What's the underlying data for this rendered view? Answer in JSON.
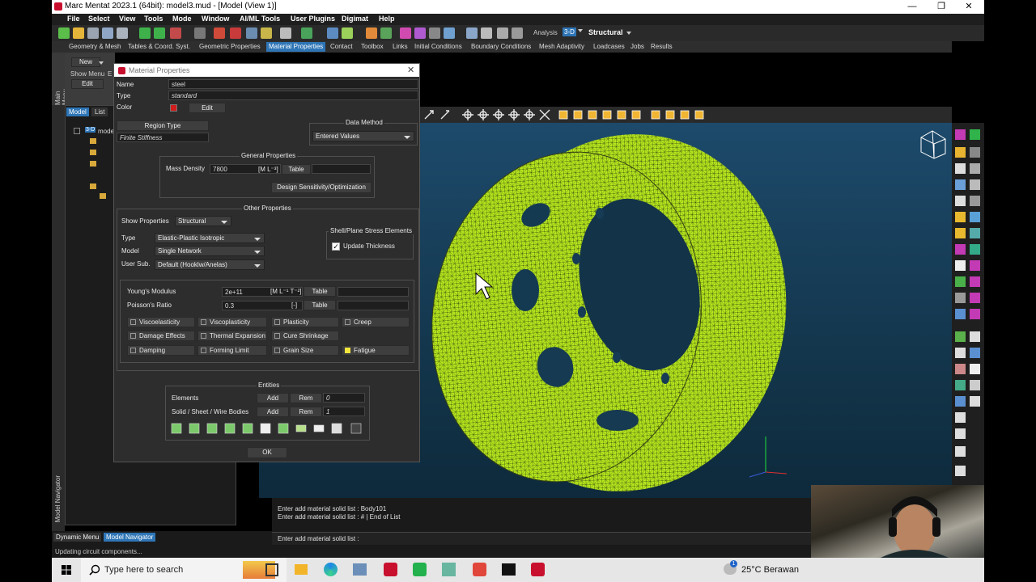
{
  "window": {
    "title": "Marc Mentat 2023.1 (64bit): model3.mud - [Model (View 1)]",
    "controls": [
      "—",
      "❐",
      "✕"
    ]
  },
  "menubar": [
    "File",
    "Select",
    "View",
    "Tools",
    "Mode",
    "Window",
    "AI/ML Tools",
    "User Plugins",
    "Digimat",
    "Help"
  ],
  "toolbar": {
    "analysis_label": "Analysis",
    "analysis_dim": "3-D",
    "analysis_type": "Structural"
  },
  "tabs": [
    "Geometry & Mesh",
    "Tables & Coord. Syst.",
    "Geometric Properties",
    "Material Properties",
    "Contact",
    "Toolbox",
    "Links",
    "Initial Conditions",
    "Boundary Conditions",
    "Mesh Adaptivity",
    "Loadcases",
    "Jobs",
    "Results"
  ],
  "active_tab": "Material Properties",
  "left_panel": {
    "main_menu_label": "Main Menu",
    "new_button": "New",
    "show_menu": "Show Menu",
    "show_menu_suffix": "E",
    "edit_button": "Edit",
    "tree_tabs": [
      "Model",
      "List"
    ],
    "tree_root": "mode",
    "tree_root_prefix": "3-D",
    "nav_label": "Model Navigator"
  },
  "dialog": {
    "title": "Material Properties",
    "name_label": "Name",
    "name_value": "steel",
    "type_label": "Type",
    "type_value": "standard",
    "color_label": "Color",
    "color_value": "#d01c1c",
    "edit_button": "Edit",
    "region_type_label": "Region Type",
    "region_type_value": "Finite Stiffness",
    "data_method_label": "Data Method",
    "data_method_value": "Entered Values",
    "general_properties": {
      "title": "General Properties",
      "mass_density_label": "Mass Density",
      "mass_density_value": "7800",
      "mass_density_unit": "[M L⁻³]",
      "table_button": "Table",
      "design_button": "Design Sensitivity/Optimization"
    },
    "other_properties": {
      "title": "Other Properties",
      "show_properties_label": "Show Properties",
      "show_properties_value": "Structural",
      "type_label": "Type",
      "type_value": "Elastic-Plastic Isotropic",
      "model_label": "Model",
      "model_value": "Single Network",
      "usersub_label": "User Sub.",
      "usersub_value": "Default (Hooklw/Anelas)",
      "shell_group_title": "Shell/Plane Stress Elements",
      "update_thickness_label": "Update Thickness",
      "update_thickness_checked": true,
      "youngs_label": "Young's Modulus",
      "youngs_value": "2e+11",
      "youngs_unit": "[M L⁻¹ T⁻²]",
      "poisson_label": "Poisson's Ratio",
      "poisson_value": "0.3",
      "poisson_unit": "[-]",
      "table_button": "Table",
      "options": [
        {
          "label": "Viscoelasticity",
          "checked": false
        },
        {
          "label": "Viscoplasticity",
          "checked": false
        },
        {
          "label": "Plasticity",
          "checked": false
        },
        {
          "label": "Creep",
          "checked": false
        },
        {
          "label": "Damage Effects",
          "checked": false
        },
        {
          "label": "Thermal Expansion",
          "checked": false
        },
        {
          "label": "Cure Shrinkage",
          "checked": false
        },
        {
          "label": "Damping",
          "checked": false
        },
        {
          "label": "Forming Limit",
          "checked": false
        },
        {
          "label": "Grain Size",
          "checked": false
        },
        {
          "label": "Fatigue",
          "checked": true,
          "accent": "#f5e63c"
        }
      ]
    },
    "entities": {
      "title": "Entities",
      "elements_label": "Elements",
      "bodies_label": "Solid / Sheet / Wire Bodies",
      "add_button": "Add",
      "rem_button": "Rem",
      "elements_count": "0",
      "bodies_count": "1"
    },
    "ok_button": "OK"
  },
  "console": {
    "lines": [
      "Enter add material solid list : Body101",
      "Enter add material solid list : # | End of List"
    ],
    "prompt": "Enter add material solid list :"
  },
  "bottom_tabs": [
    "Dynamic Menu",
    "Model Navigator"
  ],
  "active_bottom_tab": "Model Navigator",
  "status": "Updating circuit components...",
  "taskbar": {
    "search_placeholder": "Type here to search",
    "weather": "25°C  Berawan",
    "weather_badge": "1"
  },
  "colors": {
    "mesh": "#b5e61d",
    "viewport_top": "#1d4a6b",
    "accent": "#2e75b6"
  }
}
